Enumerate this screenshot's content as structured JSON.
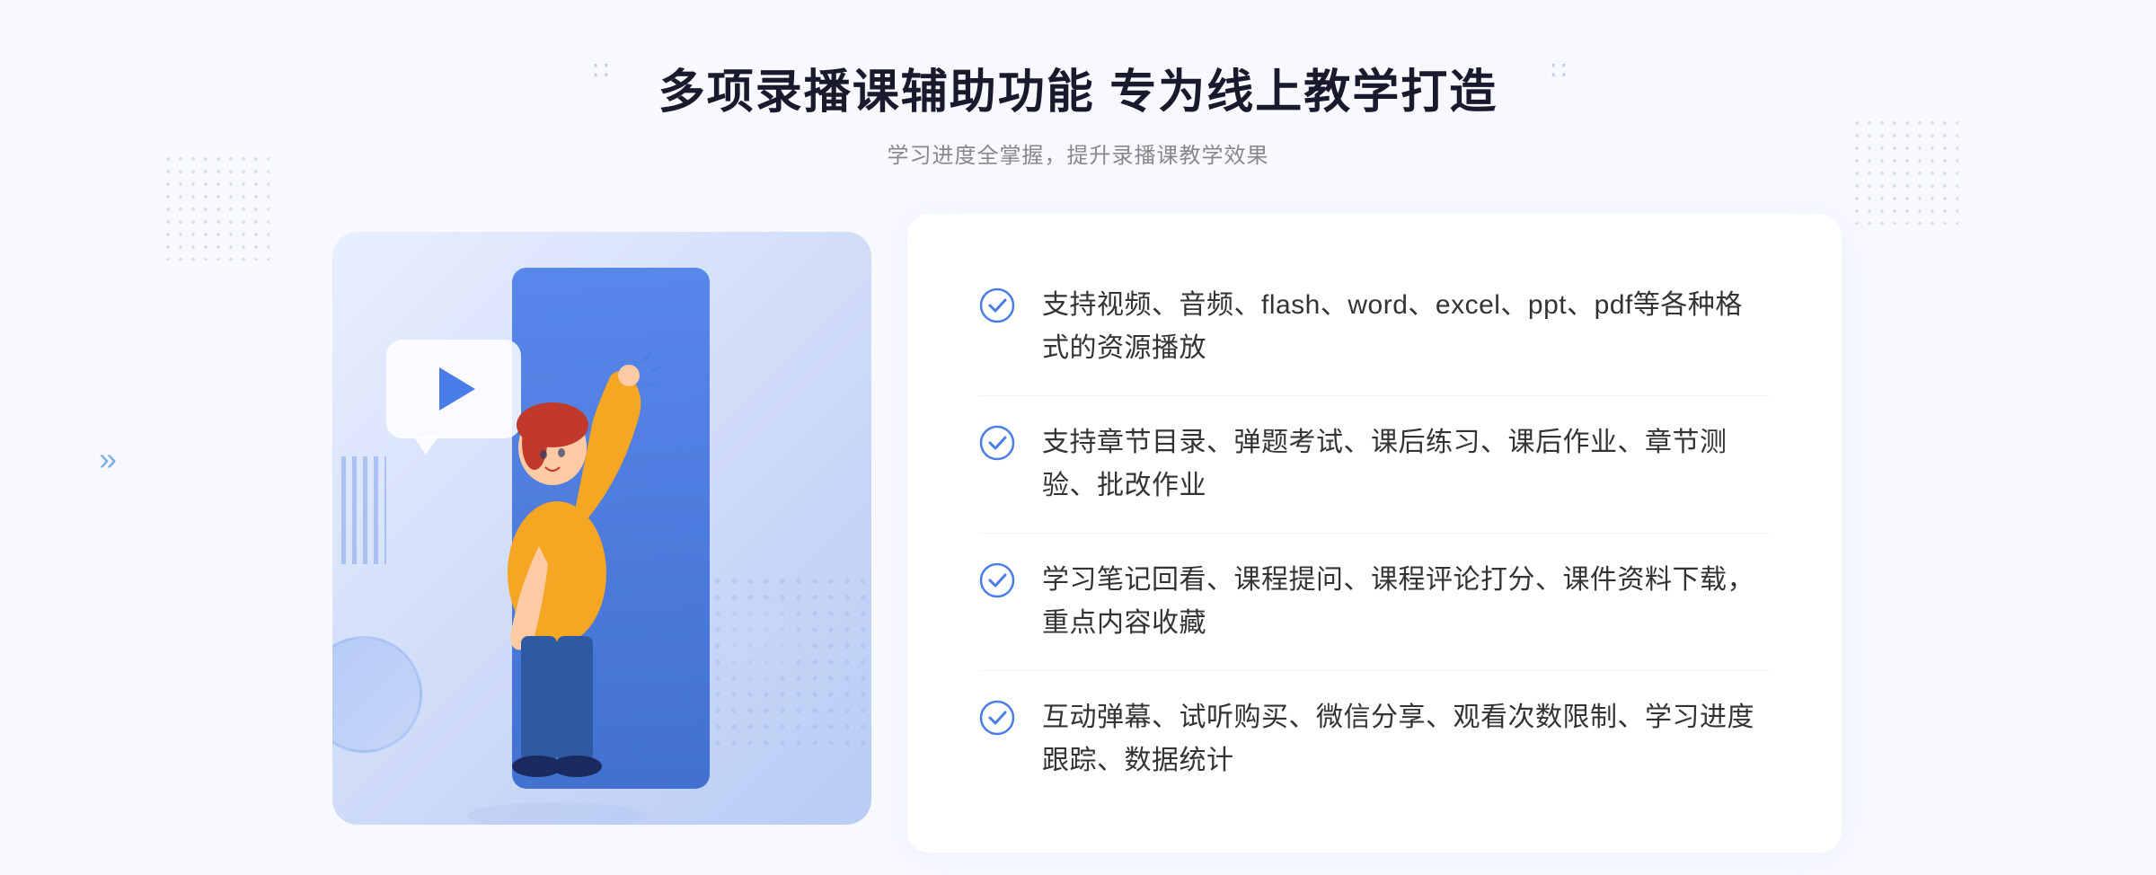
{
  "header": {
    "title": "多项录播课辅助功能 专为线上教学打造",
    "subtitle": "学习进度全掌握，提升录播课教学效果"
  },
  "decorations": {
    "chevron_left": "∷",
    "chevron_right": "∷",
    "arrow_chevrons": "»"
  },
  "features": [
    {
      "id": 1,
      "text": "支持视频、音频、flash、word、excel、ppt、pdf等各种格式的资源播放"
    },
    {
      "id": 2,
      "text": "支持章节目录、弹题考试、课后练习、课后作业、章节测验、批改作业"
    },
    {
      "id": 3,
      "text": "学习笔记回看、课程提问、课程评论打分、课件资料下载，重点内容收藏"
    },
    {
      "id": 4,
      "text": "互动弹幕、试听购买、微信分享、观看次数限制、学习进度跟踪、数据统计"
    }
  ],
  "colors": {
    "title_color": "#1a1a2e",
    "subtitle_color": "#888888",
    "accent_blue": "#4a7de8",
    "feature_text": "#333333",
    "check_color": "#4a7de8"
  }
}
